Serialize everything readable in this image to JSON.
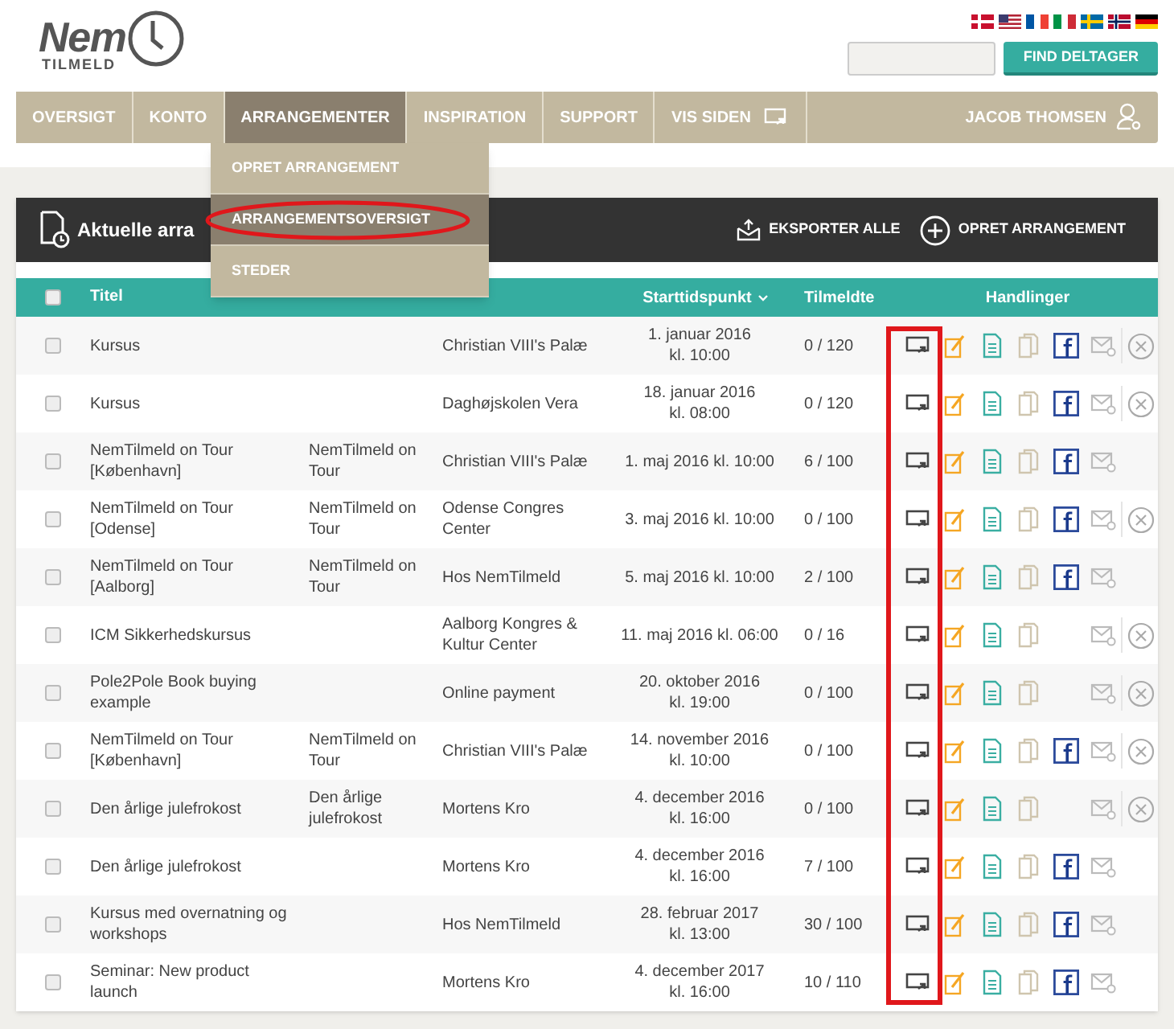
{
  "logo": {
    "word": "Nem",
    "sub": "TILMELD"
  },
  "flags": [
    {
      "kind": "dk"
    },
    {
      "kind": "us"
    },
    {
      "kind": "fr"
    },
    {
      "kind": "it"
    },
    {
      "kind": "se"
    },
    {
      "kind": "no"
    },
    {
      "kind": "de"
    }
  ],
  "search": {
    "button": "FIND DELTAGER"
  },
  "nav": [
    {
      "label": "OVERSIGT",
      "selected": false,
      "kind": "link"
    },
    {
      "label": "KONTO",
      "selected": false,
      "kind": "link"
    },
    {
      "label": "ARRANGEMENTER",
      "selected": true,
      "kind": "link"
    },
    {
      "label": "INSPIRATION",
      "selected": false,
      "kind": "link"
    },
    {
      "label": "SUPPORT",
      "selected": false,
      "kind": "link"
    },
    {
      "label": "VIS SIDEN",
      "selected": false,
      "kind": "external"
    }
  ],
  "user": "JACOB THOMSEN",
  "menu": [
    {
      "label": "OPRET ARRANGEMENT",
      "selected": false,
      "circled": false
    },
    {
      "label": "ARRANGEMENTSOVERSIGT",
      "selected": true,
      "circled": true
    },
    {
      "label": "STEDER",
      "selected": false,
      "circled": false
    }
  ],
  "panel": {
    "title": "Aktuelle arra",
    "actions": [
      {
        "kind": "export",
        "label": "EKSPORTER ALLE"
      },
      {
        "kind": "add",
        "label": "OPRET ARRANGEMENT"
      }
    ]
  },
  "table": {
    "columns": {
      "title": "Titel",
      "start": "Starttidspunkt",
      "registered": "Tilmeldte",
      "actions": "Handlinger"
    },
    "highlight_display_column": true,
    "select_all_checked": false,
    "rows": [
      {
        "checked": false,
        "title": "Kursus",
        "short": "",
        "place": "Christian VIII's Palæ",
        "start": [
          "1. januar 2016",
          "kl. 10:00"
        ],
        "registered": "0 / 120",
        "facebook": true,
        "delete": true
      },
      {
        "checked": false,
        "title": "Kursus",
        "short": "",
        "place": "Daghøjskolen Vera",
        "start": [
          "18. januar 2016",
          "kl. 08:00"
        ],
        "registered": "0 / 120",
        "facebook": true,
        "delete": true
      },
      {
        "checked": false,
        "title": "NemTilmeld on Tour [København]",
        "short": "NemTilmeld on Tour",
        "place": "Christian VIII's Palæ",
        "start": [
          "1. maj 2016 kl. 10:00"
        ],
        "registered": "6 / 100",
        "facebook": true,
        "delete": false
      },
      {
        "checked": false,
        "title": "NemTilmeld on Tour [Odense]",
        "short": "NemTilmeld on Tour",
        "place": "Odense Congres Center",
        "start": [
          "3. maj 2016 kl. 10:00"
        ],
        "registered": "0 / 100",
        "facebook": true,
        "delete": true
      },
      {
        "checked": false,
        "title": "NemTilmeld on Tour [Aalborg]",
        "short": "NemTilmeld on Tour",
        "place": "Hos NemTilmeld",
        "start": [
          "5. maj 2016 kl. 10:00"
        ],
        "registered": "2 / 100",
        "facebook": true,
        "delete": false
      },
      {
        "checked": false,
        "title": "ICM Sikkerhedskursus",
        "short": "",
        "place": "Aalborg Kongres & Kultur Center",
        "start": [
          "11. maj 2016 kl. 06:00"
        ],
        "registered": "0 / 16",
        "facebook": false,
        "delete": true
      },
      {
        "checked": false,
        "title": "Pole2Pole Book buying example",
        "short": "",
        "place": "Online payment",
        "start": [
          "20. oktober 2016",
          "kl. 19:00"
        ],
        "registered": "0 / 100",
        "facebook": false,
        "delete": true
      },
      {
        "checked": false,
        "title": "NemTilmeld on Tour [København]",
        "short": "NemTilmeld on Tour",
        "place": "Christian VIII's Palæ",
        "start": [
          "14. november 2016",
          "kl. 10:00"
        ],
        "registered": "0 / 100",
        "facebook": true,
        "delete": true
      },
      {
        "checked": false,
        "title": "Den årlige julefrokost",
        "short": "Den årlige julefrokost",
        "place": "Mortens Kro",
        "start": [
          "4. december 2016",
          "kl. 16:00"
        ],
        "registered": "0 / 100",
        "facebook": false,
        "delete": true
      },
      {
        "checked": false,
        "title": "Den årlige julefrokost",
        "short": "",
        "place": "Mortens Kro",
        "start": [
          "4. december 2016",
          "kl. 16:00"
        ],
        "registered": "7 / 100",
        "facebook": true,
        "delete": false
      },
      {
        "checked": false,
        "title": "Kursus med overnatning og workshops",
        "short": "",
        "place": "Hos NemTilmeld",
        "start": [
          "28. februar 2017",
          "kl. 13:00"
        ],
        "registered": "30 / 100",
        "facebook": true,
        "delete": false
      },
      {
        "checked": false,
        "title": "Seminar: New product launch",
        "short": "",
        "place": "Mortens Kro",
        "start": [
          "4. december 2017",
          "kl. 16:00"
        ],
        "registered": "10 / 110",
        "facebook": true,
        "delete": false
      }
    ]
  }
}
